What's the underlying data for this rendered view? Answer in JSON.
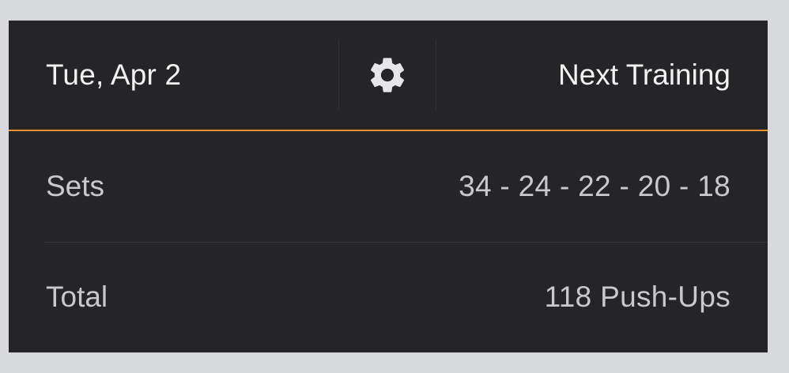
{
  "header": {
    "date": "Tue, Apr 2",
    "settings_icon": "gear-icon",
    "next_training_label": "Next Training",
    "accent_color": "#f0912f"
  },
  "rows": [
    {
      "label": "Sets",
      "value": "34 - 24 - 22 - 20 - 18"
    },
    {
      "label": "Total",
      "value": "118 Push-Ups"
    }
  ],
  "colors": {
    "background": "#d7d9dd",
    "card": "#252528",
    "primary_text": "#f2f2f3",
    "secondary_text": "#c9c9cc"
  }
}
